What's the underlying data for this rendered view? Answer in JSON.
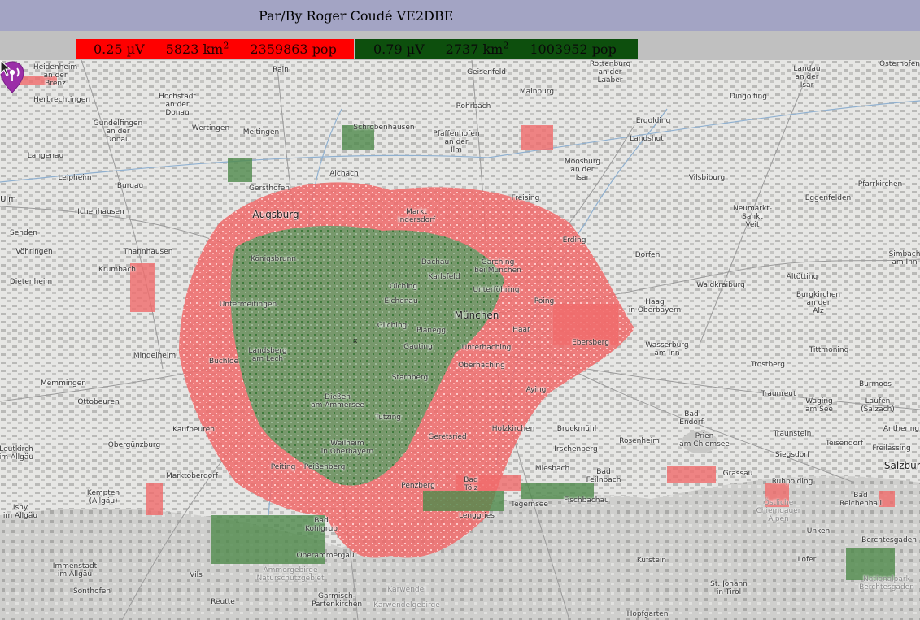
{
  "header": {
    "title": "Par/By Roger Coudé VE2DBE"
  },
  "legend": {
    "red": {
      "field_strength": "0.25 µV",
      "area_value": "5823 km",
      "area_exp": "2",
      "population": "2359863 pop",
      "color": "#ff0000"
    },
    "green": {
      "field_strength": "0.79 µV",
      "area_value": "2737 km",
      "area_exp": "2",
      "population": "1003952 pop",
      "color": "#0d4f0d"
    }
  },
  "map": {
    "marker_label": "x",
    "marker_color": "#9b2fa8",
    "places": [
      "Heidenheim\nan der\nBrenz",
      "Herbrechtingen",
      "Höchstädt\nan der\nDonau",
      "Gundelfingen\nan der\nDonau",
      "Rain",
      "Geisenfeld",
      "Landau\nan der\nIsar",
      "Osterhofen",
      "Mainburg",
      "Rottenburg\nan der\nLaaber",
      "Wertingen",
      "Meitingen",
      "Schrobenhausen",
      "Rohrbach",
      "Pfaffenhofen\nan der\nIlm",
      "Dingolfing",
      "Ergolding",
      "Landshut",
      "Langenau",
      "Leipheim",
      "Burgau",
      "Aichach",
      "Moosburg\nan der\nIsar",
      "Vilsbiburg",
      "Gersthofen",
      "Ulm",
      "Ichenhausen",
      "Augsburg",
      "Markt\nIndersdorf",
      "Freising",
      "Eggenfelden",
      "Pfarrkirchen",
      "Neumarkt-\nSankt\nVeit",
      "Senden",
      "Vöhringen",
      "Thannhausen",
      "Königsbrunn",
      "Erding",
      "Dachau",
      "Krumbach",
      "Karlsfeld",
      "Garching\nbei München",
      "Dorfen",
      "Simbach\nam Inn",
      "Dietenheim",
      "Olching",
      "Eichenau",
      "Unterföhring",
      "Altötting",
      "Waldkraiburg",
      "Burgkirchen\nan der\nAlz",
      "Untermeitingen",
      "München",
      "Poing",
      "Haag\nin Oberbayern",
      "Gilching",
      "Planegg",
      "Haar",
      "Mindelheim",
      "Buchloe",
      "Landsberg\nam Lech",
      "Gauting",
      "Unterhaching",
      "Ebersberg",
      "Wasserburg\nam Inn",
      "Tittmoning",
      "Oberhaching",
      "Trostberg",
      "Memmingen",
      "Starnberg",
      "Aying",
      "Burmoos",
      "Ottobeuren",
      "Dießen\nam Ammersee",
      "Traunreut",
      "Waging\nam See",
      "Laufen\n(Salzach)",
      "Kaufbeuren",
      "Tutzing",
      "Holzkirchen",
      "Bruckmühl",
      "Bad\nEndorf",
      "Leutkirch\nim Allgäu",
      "Obergünzburg",
      "Geretsried",
      "Rosenheim",
      "Prien\nam Chiemsee",
      "Traunstein",
      "Anthering",
      "Weilheim\nin Oberbayern",
      "Teisendorf",
      "Freilassing",
      "Irschenberg",
      "Marktoberdorf",
      "Peiting",
      "Peißenberg",
      "Miesbach",
      "Bad\nFeilnbach",
      "Siegsdorf",
      "Salzburg",
      "Grassau",
      "Kempten\n(Allgäu)",
      "Penzberg",
      "Bad\nTölz",
      "Ruhpolding",
      "Fischbachau",
      "Isny\nim Allgäu",
      "Tegernsee",
      "Lenggries",
      "Bad\nReichenhall",
      "Östliche\nChiemgauer\nAlpen",
      "Bad\nKohlgrub",
      "Unken",
      "Berchtesgaden",
      "Oberammergau",
      "Kufstein",
      "Lofer",
      "Immenstadt\nim Allgäu",
      "Ammergebirge\nNaturschutzgebiet",
      "Vils",
      "Nationalpark\nBerchtesgaden",
      "Sonthofen",
      "Karwendel",
      "St. Johann\nin Tirol",
      "Garmisch-\nPartenkirchen",
      "Karwendelgebirge",
      "Reutte",
      "Hopfgarten"
    ]
  }
}
